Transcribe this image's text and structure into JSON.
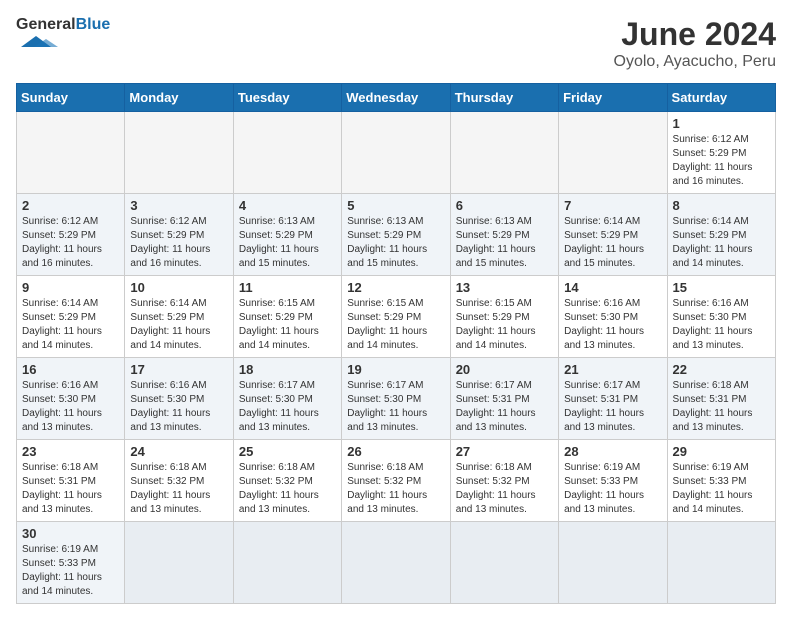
{
  "header": {
    "logo_general": "General",
    "logo_blue": "Blue",
    "month_title": "June 2024",
    "subtitle": "Oyolo, Ayacucho, Peru"
  },
  "weekdays": [
    "Sunday",
    "Monday",
    "Tuesday",
    "Wednesday",
    "Thursday",
    "Friday",
    "Saturday"
  ],
  "weeks": [
    [
      {
        "day": "",
        "info": ""
      },
      {
        "day": "",
        "info": ""
      },
      {
        "day": "",
        "info": ""
      },
      {
        "day": "",
        "info": ""
      },
      {
        "day": "",
        "info": ""
      },
      {
        "day": "",
        "info": ""
      },
      {
        "day": "1",
        "info": "Sunrise: 6:12 AM\nSunset: 5:29 PM\nDaylight: 11 hours and 16 minutes."
      }
    ],
    [
      {
        "day": "2",
        "info": "Sunrise: 6:12 AM\nSunset: 5:29 PM\nDaylight: 11 hours and 16 minutes."
      },
      {
        "day": "3",
        "info": "Sunrise: 6:12 AM\nSunset: 5:29 PM\nDaylight: 11 hours and 16 minutes."
      },
      {
        "day": "4",
        "info": "Sunrise: 6:13 AM\nSunset: 5:29 PM\nDaylight: 11 hours and 15 minutes."
      },
      {
        "day": "5",
        "info": "Sunrise: 6:13 AM\nSunset: 5:29 PM\nDaylight: 11 hours and 15 minutes."
      },
      {
        "day": "6",
        "info": "Sunrise: 6:13 AM\nSunset: 5:29 PM\nDaylight: 11 hours and 15 minutes."
      },
      {
        "day": "7",
        "info": "Sunrise: 6:14 AM\nSunset: 5:29 PM\nDaylight: 11 hours and 15 minutes."
      },
      {
        "day": "8",
        "info": "Sunrise: 6:14 AM\nSunset: 5:29 PM\nDaylight: 11 hours and 14 minutes."
      }
    ],
    [
      {
        "day": "9",
        "info": "Sunrise: 6:14 AM\nSunset: 5:29 PM\nDaylight: 11 hours and 14 minutes."
      },
      {
        "day": "10",
        "info": "Sunrise: 6:14 AM\nSunset: 5:29 PM\nDaylight: 11 hours and 14 minutes."
      },
      {
        "day": "11",
        "info": "Sunrise: 6:15 AM\nSunset: 5:29 PM\nDaylight: 11 hours and 14 minutes."
      },
      {
        "day": "12",
        "info": "Sunrise: 6:15 AM\nSunset: 5:29 PM\nDaylight: 11 hours and 14 minutes."
      },
      {
        "day": "13",
        "info": "Sunrise: 6:15 AM\nSunset: 5:29 PM\nDaylight: 11 hours and 14 minutes."
      },
      {
        "day": "14",
        "info": "Sunrise: 6:16 AM\nSunset: 5:30 PM\nDaylight: 11 hours and 13 minutes."
      },
      {
        "day": "15",
        "info": "Sunrise: 6:16 AM\nSunset: 5:30 PM\nDaylight: 11 hours and 13 minutes."
      }
    ],
    [
      {
        "day": "16",
        "info": "Sunrise: 6:16 AM\nSunset: 5:30 PM\nDaylight: 11 hours and 13 minutes."
      },
      {
        "day": "17",
        "info": "Sunrise: 6:16 AM\nSunset: 5:30 PM\nDaylight: 11 hours and 13 minutes."
      },
      {
        "day": "18",
        "info": "Sunrise: 6:17 AM\nSunset: 5:30 PM\nDaylight: 11 hours and 13 minutes."
      },
      {
        "day": "19",
        "info": "Sunrise: 6:17 AM\nSunset: 5:30 PM\nDaylight: 11 hours and 13 minutes."
      },
      {
        "day": "20",
        "info": "Sunrise: 6:17 AM\nSunset: 5:31 PM\nDaylight: 11 hours and 13 minutes."
      },
      {
        "day": "21",
        "info": "Sunrise: 6:17 AM\nSunset: 5:31 PM\nDaylight: 11 hours and 13 minutes."
      },
      {
        "day": "22",
        "info": "Sunrise: 6:18 AM\nSunset: 5:31 PM\nDaylight: 11 hours and 13 minutes."
      }
    ],
    [
      {
        "day": "23",
        "info": "Sunrise: 6:18 AM\nSunset: 5:31 PM\nDaylight: 11 hours and 13 minutes."
      },
      {
        "day": "24",
        "info": "Sunrise: 6:18 AM\nSunset: 5:32 PM\nDaylight: 11 hours and 13 minutes."
      },
      {
        "day": "25",
        "info": "Sunrise: 6:18 AM\nSunset: 5:32 PM\nDaylight: 11 hours and 13 minutes."
      },
      {
        "day": "26",
        "info": "Sunrise: 6:18 AM\nSunset: 5:32 PM\nDaylight: 11 hours and 13 minutes."
      },
      {
        "day": "27",
        "info": "Sunrise: 6:18 AM\nSunset: 5:32 PM\nDaylight: 11 hours and 13 minutes."
      },
      {
        "day": "28",
        "info": "Sunrise: 6:19 AM\nSunset: 5:33 PM\nDaylight: 11 hours and 13 minutes."
      },
      {
        "day": "29",
        "info": "Sunrise: 6:19 AM\nSunset: 5:33 PM\nDaylight: 11 hours and 14 minutes."
      }
    ],
    [
      {
        "day": "30",
        "info": "Sunrise: 6:19 AM\nSunset: 5:33 PM\nDaylight: 11 hours and 14 minutes."
      },
      {
        "day": "",
        "info": ""
      },
      {
        "day": "",
        "info": ""
      },
      {
        "day": "",
        "info": ""
      },
      {
        "day": "",
        "info": ""
      },
      {
        "day": "",
        "info": ""
      },
      {
        "day": "",
        "info": ""
      }
    ]
  ]
}
